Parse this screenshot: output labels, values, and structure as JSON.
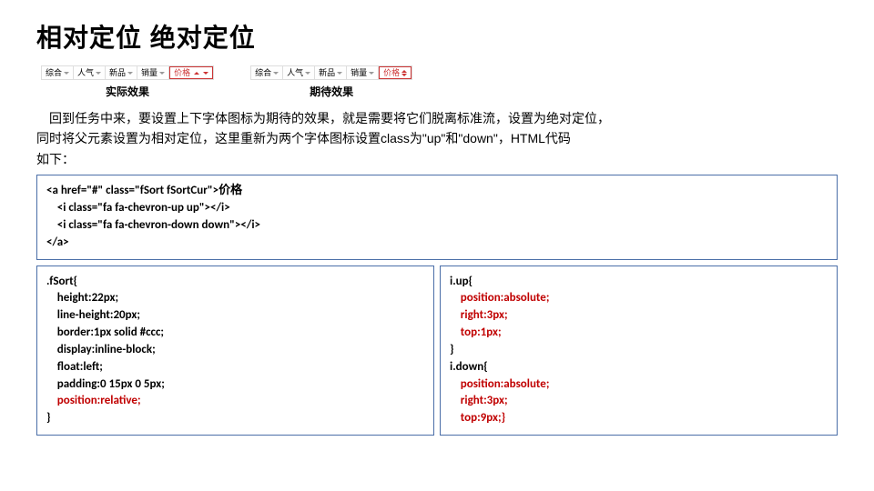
{
  "title": "相对定位 绝对定位",
  "figures": {
    "left_caption": "实际效果",
    "right_caption": "期待效果",
    "tabs_left": [
      "综合",
      "人气",
      "新品",
      "销量",
      "价格"
    ],
    "tabs_right": [
      "综合",
      "人气",
      "新品",
      "销量",
      "价格"
    ]
  },
  "paragraph_line1": "回到任务中来，要设置上下字体图标为期待的效果，就是需要将它们脱离标准流，设置为绝对定位，",
  "paragraph_line2": "同时将父元素设置为相对定位，这里重新为两个字体图标设置class为\"up\"和\"down\"，HTML代码",
  "paragraph_line3": "如下：",
  "code1": {
    "ln1": "<a href=\"#\" class=\"fSort fSortCur\">价格",
    "ln2": "    <i class=\"fa fa-chevron-up up\"></i>",
    "ln3": "    <i class=\"fa fa-chevron-down down\"></i>",
    "ln4": "</a>"
  },
  "code2": {
    "ln1": ".fSort{",
    "ln2": "    height:22px;",
    "ln3": "    line-height:20px;",
    "ln4": "    border:1px solid #ccc;",
    "ln5": "    display:inline-block;",
    "ln6": "    float:left;",
    "ln7": "    padding:0 15px 0 5px;",
    "ln8": "    position:relative;",
    "ln9": "}"
  },
  "code3": {
    "ln1": "i.up{",
    "ln2": "    position:absolute;",
    "ln3": "    right:3px;",
    "ln4": "    top:1px;",
    "ln5": "}",
    "ln6": "i.down{",
    "ln7": "    position:absolute;",
    "ln8": "    right:3px;",
    "ln9": "    top:9px;}"
  }
}
